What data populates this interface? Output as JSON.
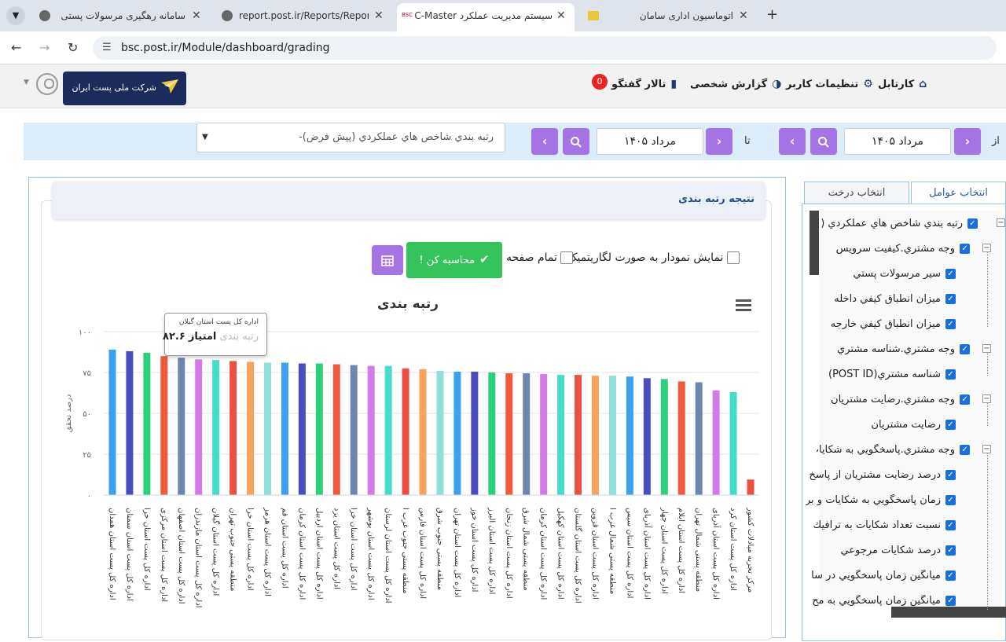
{
  "browser": {
    "tabs": [
      {
        "title": "سامانه رهگیری مرسولات پستی"
      },
      {
        "title": "report.post.ir/Reports/Report10"
      },
      {
        "title": "سیستم مدیریت عملکرد C-Master"
      },
      {
        "title": "اتوماسیون اداری سامان"
      }
    ],
    "favicon_bsc": "BSC",
    "url": "bsc.post.ir/Module/dashboard/grading"
  },
  "header": {
    "logo_text": "شرکت ملی پست ایران",
    "nav": [
      {
        "label": "کارتابل",
        "icon": "home-icon"
      },
      {
        "label": "تنظیمات کاربر",
        "icon": "gear-icon"
      },
      {
        "label": "گزارش شخصی",
        "icon": "pie-chart-icon"
      },
      {
        "label": "تالار گفتگو",
        "icon": "chat-icon"
      }
    ],
    "chat_badge": "0"
  },
  "filter": {
    "from_label": "از",
    "to_label": "تا",
    "from_date": "مرداد ۱۴۰۵",
    "to_date": "مرداد ۱۴۰۵",
    "select_value": "رتبه بندي شاخص هاي عملكردي (پيش فرض)-"
  },
  "results": {
    "title": "نتیجه رتبه بندی",
    "log_checkbox_label": "نمایش نمودار به صورت لگاریتمیک",
    "fullpage_label": "تمام صفحه",
    "calc_button": "محاسبه کن !"
  },
  "chart_data": {
    "type": "bar",
    "title": "رتبه بندی",
    "ylabel": "درصد تحقق",
    "ylim": [
      0,
      100
    ],
    "yticks": [
      "۰",
      "۲۵",
      "۵۰",
      "۷۵",
      "۱۰۰"
    ],
    "categories": [
      "اداره کل پست استان همدان",
      "اداره کل پست استان سمنان",
      "اداره کل پست استان خرا",
      "اداره کل پست استان مرکزی",
      "اداره کل پست استان اصفهان",
      "اداره کل پست استان مازندران",
      "اداره کل پست استان گیلان",
      "منطقه پستی جنوب تهران",
      "اداره کل پست استان خرا",
      "اداره کل پست استان هرمز",
      "اداره کل پست استان قم",
      "اداره کل پست استان کرمان",
      "اداره کل پست استان اردبیل",
      "اداره کل پست استان یزد",
      "اداره کل پست استان خرا",
      "اداره کل پست استان بوشهر",
      "اداره کل پست استان لرستان",
      "منطقه پستی جنوب غرب ا",
      "اداره کل پست استان فارس",
      "منطقه پستی جنوب شرق",
      "اداره کل پست استان تهران",
      "اداره کل پست استان خوز",
      "اداره کل پست استان البرز",
      "اداره کل پست استان زنجان",
      "منطقه پستی شمال شرق",
      "اداره کل پست استان کرمان",
      "اداره کل پست استان کهکیل",
      "اداره کل پست استان گلستان",
      "اداره کل پست استان قزوین",
      "منطقه پستی شمال غرب ا",
      "اداره کل پست استان سیس",
      "اداره کل پست استان آذربای",
      "اداره کل پست استان چهار",
      "اداره کل پست استان ایلام",
      "منطقه پستی شمال تهران",
      "اداره کل پست استان آذربای",
      "اداره کل پست استان کرد",
      "مرکز تجربه میادلات کشور"
    ],
    "values": [
      89,
      88,
      87,
      85,
      84,
      83,
      82.6,
      82,
      81.5,
      81,
      81,
      80.5,
      80.5,
      80,
      79.5,
      79,
      79,
      77.5,
      77,
      76,
      75.5,
      75.5,
      75,
      74.5,
      74.5,
      74,
      73.5,
      73.5,
      73,
      73,
      72.5,
      71.5,
      71,
      69.5,
      69,
      64,
      63,
      9.5
    ],
    "colors": [
      "#3aa0f0",
      "#4a4dc0",
      "#2cd07a",
      "#ef5a3c",
      "#6d86ad",
      "#d27be8",
      "#45dcc8",
      "#ec4f44",
      "#f7a35c",
      "#90e0d8",
      "#3aa0f0",
      "#4a4dc0",
      "#2cd07a",
      "#ef5a3c",
      "#6d86ad",
      "#d27be8",
      "#45dcc8",
      "#ec4f44",
      "#f7a35c",
      "#90e0d8",
      "#3aa0f0",
      "#4a4dc0",
      "#2cd07a",
      "#ef5a3c",
      "#6d86ad",
      "#d27be8",
      "#45dcc8",
      "#ec4f44",
      "#f7a35c",
      "#90e0d8",
      "#3aa0f0",
      "#4a4dc0",
      "#2cd07a",
      "#ef5a3c",
      "#6d86ad",
      "#d27be8",
      "#45dcc8",
      "#ec4f44"
    ],
    "grid": true,
    "tooltip": {
      "name": "اداره کل پست استان گیلان",
      "series": "رتبه بندی",
      "label": "امتیاز",
      "value": "۸۲.۶"
    }
  },
  "sidebar": {
    "tabs": [
      {
        "label": "انتخاب عوامل"
      },
      {
        "label": "انتخاب درخت"
      }
    ],
    "tree": [
      {
        "label": "رتبه بندي شاخص هاي عملكردي (پيش",
        "level": 0
      },
      {
        "label": "وجه مشتري.کیفیت سرویس",
        "level": 1
      },
      {
        "label": "سیر مرسولات پستي",
        "level": 2
      },
      {
        "label": "میزان انطباق کیفي داخله",
        "level": 2
      },
      {
        "label": "میزان انطباق کیفي خارجه",
        "level": 2
      },
      {
        "label": "وجه مشتري.شناسه مشتري",
        "level": 1
      },
      {
        "label": "شناسه مشتري(POST ID)",
        "level": 2
      },
      {
        "label": "وجه مشتري.رضايت مشتريان",
        "level": 1
      },
      {
        "label": "رضايت مشتريان",
        "level": 2
      },
      {
        "label": "وجه مشتري.پاسخگويي به شكايات",
        "level": 1
      },
      {
        "label": "درصد رضايت مشتريان از پاسخ",
        "level": 2
      },
      {
        "label": "زمان پاسخگويي به شكايات و بر",
        "level": 2
      },
      {
        "label": "نسبت تعداد شكايات به ترافيك",
        "level": 2
      },
      {
        "label": "درصد شكايات مرجوعي",
        "level": 2
      },
      {
        "label": "ميانگين زمان پاسخگويي در سا",
        "level": 2
      },
      {
        "label": "ميانگين زمان پاسخگويي به مح",
        "level": 2
      }
    ]
  }
}
